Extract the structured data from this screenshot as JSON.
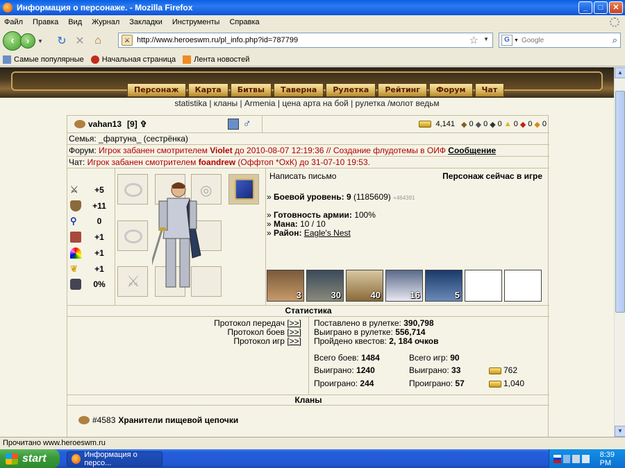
{
  "window": {
    "title": "Информация о персонаже. - Mozilla Firefox",
    "minimize": "_",
    "maximize": "□",
    "close": "✕"
  },
  "menu": [
    "Файл",
    "Правка",
    "Вид",
    "Журнал",
    "Закладки",
    "Инструменты",
    "Справка"
  ],
  "nav": {
    "url": "http://www.heroeswm.ru/pl_info.php?id=787799",
    "search_placeholder": "Google",
    "search_engine": "G"
  },
  "bookmarks": [
    "Самые популярные",
    "Начальная страница",
    "Лента новостей"
  ],
  "game_nav": [
    "Персонаж",
    "Карта",
    "Битвы",
    "Таверна",
    "Рулетка",
    "Рейтинг",
    "Форум",
    "Чат"
  ],
  "sublinks": "statistika | кланы | Armenia | цена арта на бой | рулетка /молот ведьм",
  "player": {
    "name": "vahan13",
    "level": "[9]",
    "gold": "4,141",
    "resources": [
      "0",
      "0",
      "0",
      "0",
      "0",
      "0"
    ],
    "family_label": "Семья:",
    "family_value": "_фартуна_ (сестрёнка)",
    "forum_label": "Форум:",
    "forum_ban": "Игрок забанен смотрителем",
    "forum_moderator": "Violet",
    "forum_reason": "до 2010-08-07 12:19:36 // Создание флудотемы в ОИФ",
    "forum_link": "Сообщение",
    "chat_label": "Чат:",
    "chat_ban": "Игрок забанен смотрителем",
    "chat_moderator": "foandrew",
    "chat_reason": "(Оффтоп *ОхК) до 31-07-10 19:53."
  },
  "stats": [
    {
      "icon": "attack-icon",
      "value": "+5"
    },
    {
      "icon": "defense-icon",
      "value": "+11"
    },
    {
      "icon": "spellpower-icon",
      "value": "0"
    },
    {
      "icon": "knowledge-icon",
      "value": "+1"
    },
    {
      "icon": "luck-icon",
      "value": "+1"
    },
    {
      "icon": "morale-icon",
      "value": "+1"
    },
    {
      "icon": "initiative-icon",
      "value": "0%"
    }
  ],
  "info": {
    "write_letter": "Написать письмо",
    "status": "Персонаж сейчас в игре",
    "combat_label": "Боевой уровень:",
    "combat_value": "9",
    "combat_exp": "(1185609)",
    "combat_plus": "+464391",
    "army_label": "Готовность армии:",
    "army_value": "100%",
    "mana_label": "Мана:",
    "mana_value": "10 / 10",
    "district_label": "Район:",
    "district_value": "Eagle's Nest"
  },
  "troops": [
    "3",
    "30",
    "40",
    "16",
    "5",
    "",
    ""
  ],
  "sections": {
    "statistics": "Статистика",
    "clans": "Кланы"
  },
  "protocols": [
    {
      "label": "Протокол передач",
      "link": "[>>]"
    },
    {
      "label": "Протокол боев",
      "link": "[>>]"
    },
    {
      "label": "Протокол игр",
      "link": "[>>]"
    }
  ],
  "gambling": {
    "bet_label": "Поставлено в рулетке:",
    "bet_value": "390,798",
    "won_label": "Выиграно в рулетке:",
    "won_value": "556,714",
    "quests_label": "Пройдено квестов:",
    "quests_value": "2, 184 очков",
    "battles_label": "Всего боев:",
    "battles_value": "1484",
    "bwon_label": "Выиграно:",
    "bwon_value": "1240",
    "blost_label": "Проиграно:",
    "blost_value": "244",
    "games_label": "Всего игр:",
    "games_value": "90",
    "gwon_label": "Выиграно:",
    "gwon_value": "33",
    "glost_label": "Проиграно:",
    "glost_value": "57",
    "gold_won": "762",
    "gold_lost": "1,040"
  },
  "clan": {
    "id": "#4583",
    "name": "Хранители пищевой цепочки"
  },
  "statusbar": "Прочитано www.heroeswm.ru",
  "taskbar": {
    "start": "start",
    "task": "Информация о персо...",
    "time": "8:39 PM"
  }
}
